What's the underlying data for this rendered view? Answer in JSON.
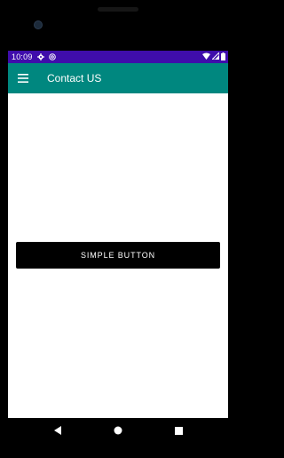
{
  "status_bar": {
    "time": "10:09",
    "left_icons": [
      "gear-icon",
      "at-sign-icon"
    ],
    "right_icons": [
      "wifi-icon",
      "signal-icon",
      "battery-icon"
    ],
    "color": "#3f0dab"
  },
  "app_bar": {
    "title": "Contact US",
    "menu_icon": "hamburger-menu-icon",
    "color": "#00877f"
  },
  "main": {
    "button_label": "SIMPLE BUTTON",
    "button_color": "#000000"
  },
  "nav_bar": {
    "buttons": [
      "back-icon",
      "home-icon",
      "recents-icon"
    ]
  }
}
